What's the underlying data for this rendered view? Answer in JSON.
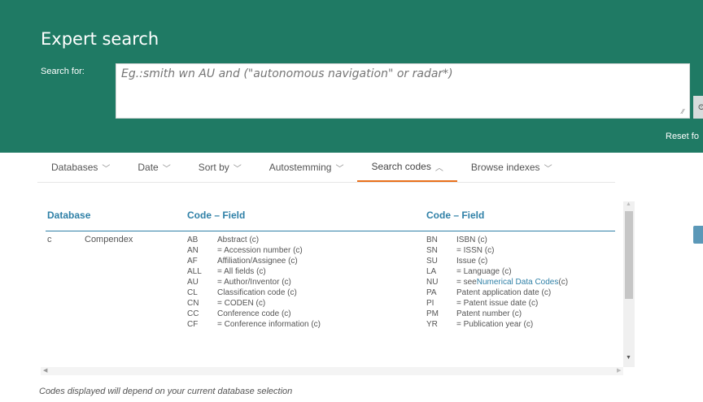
{
  "header": {
    "title": "Expert search",
    "search_label": "Search for:",
    "search_placeholder": "Eg.:smith wn AU and (\"autonomous navigation\" or radar*)",
    "resize_grip": "⁄⁄",
    "search_button": "ⵙ",
    "reset_link": "Reset fo"
  },
  "tabs": [
    {
      "label": "Databases",
      "chevron": "﹀"
    },
    {
      "label": "Date",
      "chevron": "﹀"
    },
    {
      "label": "Sort by",
      "chevron": "﹀"
    },
    {
      "label": "Autostemming",
      "chevron": "﹀"
    },
    {
      "label": "Search codes",
      "chevron": "︿"
    },
    {
      "label": "Browse indexes",
      "chevron": "﹀"
    }
  ],
  "codes_table": {
    "headers": {
      "database": "Database",
      "code_field_1": "Code – Field",
      "code_field_2": "Code – Field"
    },
    "database": {
      "letter": "c",
      "name": "Compendex"
    },
    "column1": [
      {
        "code": "AB",
        "desc": "Abstract (c)"
      },
      {
        "code": "AN",
        "desc": "= Accession number (c)"
      },
      {
        "code": "AF",
        "desc": "Affiliation/Assignee (c)"
      },
      {
        "code": "ALL",
        "desc": "= All fields (c)"
      },
      {
        "code": "AU",
        "desc": "= Author/Inventor (c)"
      },
      {
        "code": "CL",
        "desc": "Classification code (c)"
      },
      {
        "code": "CN",
        "desc": "= CODEN (c)"
      },
      {
        "code": "CC",
        "desc": "Conference code (c)"
      },
      {
        "code": "CF",
        "desc": "= Conference information (c)"
      }
    ],
    "column2": [
      {
        "code": "BN",
        "desc": "ISBN (c)"
      },
      {
        "code": "SN",
        "desc": "= ISSN (c)"
      },
      {
        "code": "SU",
        "desc": "Issue (c)"
      },
      {
        "code": "LA",
        "desc": "= Language (c)"
      },
      {
        "code": "NU",
        "desc": "= see ",
        "link": "Numerical Data Codes",
        "suffix": " (c)"
      },
      {
        "code": "PA",
        "desc": "Patent application date (c)"
      },
      {
        "code": "PI",
        "desc": "= Patent issue date (c)"
      },
      {
        "code": "PM",
        "desc": "Patent number (c)"
      },
      {
        "code": "YR",
        "desc": "= Publication year (c)"
      }
    ]
  },
  "scrollbar": {
    "up": "▲",
    "down": "▼",
    "left": "◀",
    "right": "▶"
  },
  "footnote": "Codes displayed will depend on your current database selection",
  "colors": {
    "header_bg": "#1f7a64",
    "accent": "#2f80a7",
    "active_tab": "#e9711c"
  }
}
